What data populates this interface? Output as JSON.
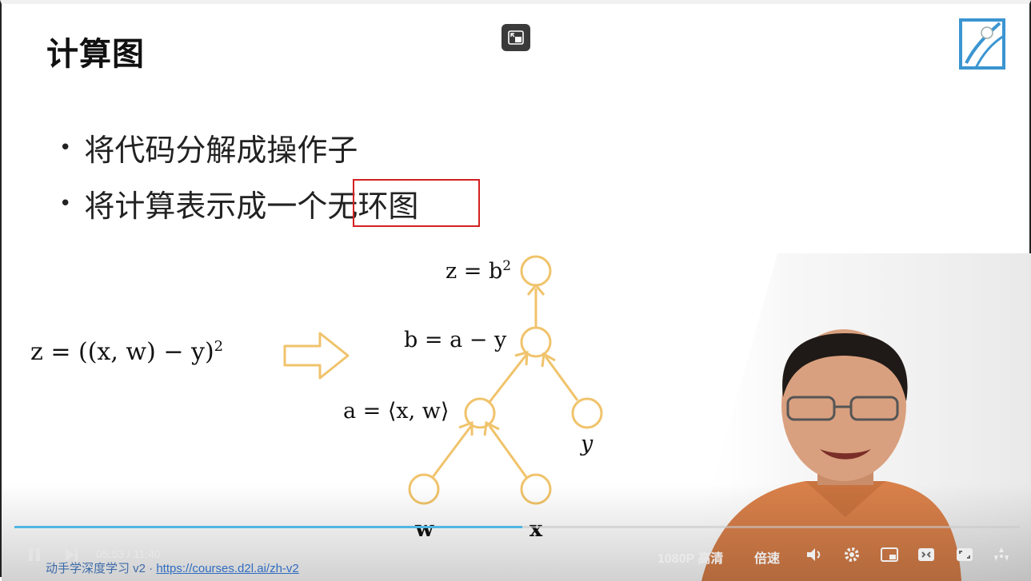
{
  "slide": {
    "title": "计算图",
    "bullets": [
      {
        "prefix": "将代码分解成操作子",
        "highlight": ""
      },
      {
        "prefix": "将计算表示成一个",
        "highlight": "无环图"
      }
    ],
    "bullet_dot": "•"
  },
  "formula": {
    "text": "z = ((x, w) − y)",
    "superscript": "2"
  },
  "graph": {
    "labels": {
      "z": "z = b",
      "z_sup": "2",
      "b": "b = a − y",
      "a": "a = ⟨x, w⟩",
      "y": "y",
      "w": "w",
      "x": "x"
    },
    "colors": {
      "node": "#f0c36b",
      "arrow": "#f0c36b"
    }
  },
  "player": {
    "time_current": "05:53",
    "time_sep": "/",
    "time_total": "11:40",
    "quality": "1080P 高清",
    "speed": "倍速",
    "progress": 0.505,
    "footer_course": "动手学深度学习 v2 · ",
    "footer_link": "https://courses.d2l.ai/zh-v2",
    "accent": "#4fb6e3"
  },
  "icons": [
    "pip-icon",
    "d2l-logo-icon",
    "play-pause-icon",
    "next-icon",
    "volume-icon",
    "settings-icon",
    "pip-window-icon",
    "widescreen-icon",
    "fullscreen-icon",
    "danmaku-icon"
  ]
}
